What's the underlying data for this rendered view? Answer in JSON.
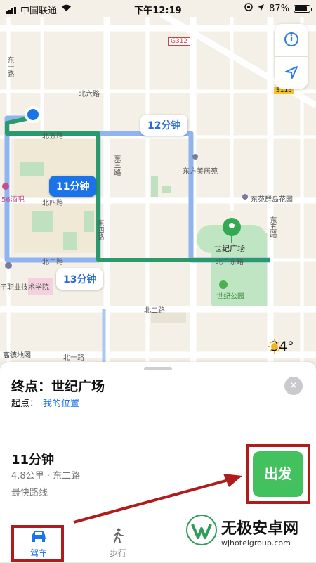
{
  "status_bar": {
    "carrier": "中国联通",
    "time": "下午12:19",
    "battery": "87%",
    "battery_level": 0.87
  },
  "map": {
    "labels": {
      "road_dongyi": "东一路",
      "g312": "G312",
      "s115": "S115",
      "beiliu": "北六路",
      "beiwu": "北五路",
      "dongsan": "东三路",
      "dongfang": "东方美居苑",
      "bar56": "56酒吧",
      "beisi": "北四路",
      "dongyuan": "东苑群岛花园",
      "dongwu": "东五路",
      "shiji_square": "世纪广场",
      "dongsi": "东四路",
      "beier": "北二路",
      "beier_east": "北二东路",
      "college": "子职业技术学院",
      "shiji_park": "世纪公园",
      "beiersouth": "北二路",
      "gaode": "高德地图",
      "beiyi": "北一路"
    },
    "bubbles": {
      "route_a": "12分钟",
      "route_b": "11分钟",
      "route_c": "13分钟"
    },
    "weather_temp": "34°",
    "icons": [
      "info-icon",
      "location-arrow-icon",
      "sun-icon",
      "destination-pin-icon"
    ]
  },
  "route_card": {
    "destination": "终点：世纪广场",
    "origin_label": "起点：",
    "origin_value": "我的位置",
    "duration": "11分钟",
    "distance_via": "4.8公里 · 东二路",
    "note": "最快路线",
    "go_label": "出发",
    "close_icon": "close-icon"
  },
  "tabs": [
    {
      "label": "驾车",
      "icon": "car-icon",
      "active": true
    },
    {
      "label": "步行",
      "icon": "walk-icon",
      "active": false
    }
  ],
  "watermark": {
    "title": "无极安卓网",
    "url": "wjhotelgroup.com"
  },
  "colors": {
    "route_active": "#2b9a6a",
    "route_alt": "#8fb4ef",
    "accent": "#1a73e8",
    "go": "#42c15e",
    "annotation": "#b01b1b"
  }
}
